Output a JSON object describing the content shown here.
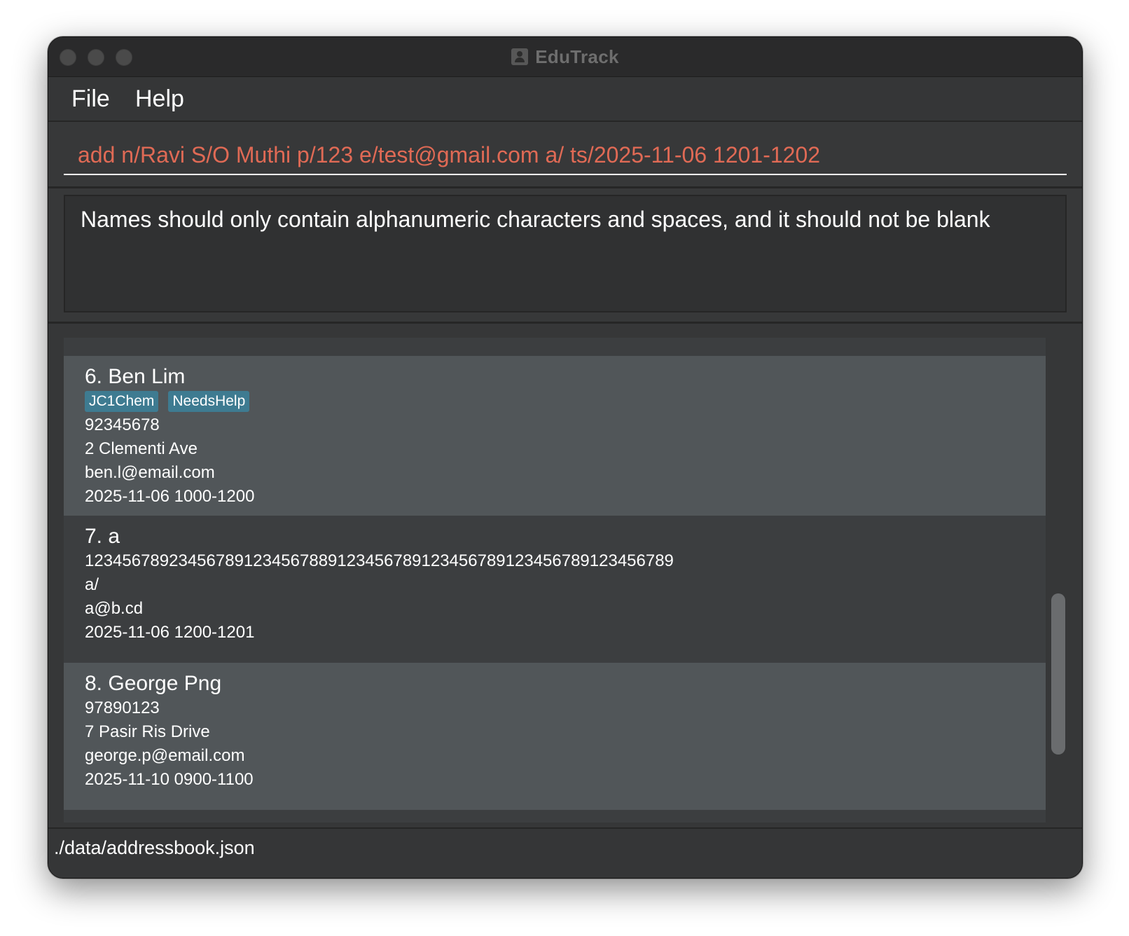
{
  "window": {
    "title": "EduTrack"
  },
  "menu": {
    "file": "File",
    "help": "Help"
  },
  "command": {
    "value": "add n/Ravi S/O Muthi p/123 e/test@gmail.com a/ ts/2025-11-06 1201-1202",
    "color": "#e06a55"
  },
  "result": {
    "message": "Names should only contain alphanumeric characters and spaces, and it should not be blank"
  },
  "persons": [
    {
      "index_name": "6. Ben Lim",
      "tags": [
        "JC1Chem",
        "NeedsHelp"
      ],
      "phone": "92345678",
      "address": "2 Clementi Ave",
      "email": "ben.l@email.com",
      "timeslot": "2025-11-06 1000-1200"
    },
    {
      "index_name": "7. a",
      "tags": [],
      "phone": "123456789234567891234567889123456789123456789123456789123456789",
      "address": "a/",
      "email": "a@b.cd",
      "timeslot": "2025-11-06 1200-1201"
    },
    {
      "index_name": "8. George Png",
      "tags": [],
      "phone": "97890123",
      "address": "7 Pasir Ris Drive",
      "email": "george.p@email.com",
      "timeslot": "2025-11-10 0900-1100"
    }
  ],
  "status": {
    "path": "./data/addressbook.json"
  },
  "colors": {
    "tag_background": "#3e7b91",
    "card_even": "#515659",
    "card_odd": "#3c3e40"
  }
}
